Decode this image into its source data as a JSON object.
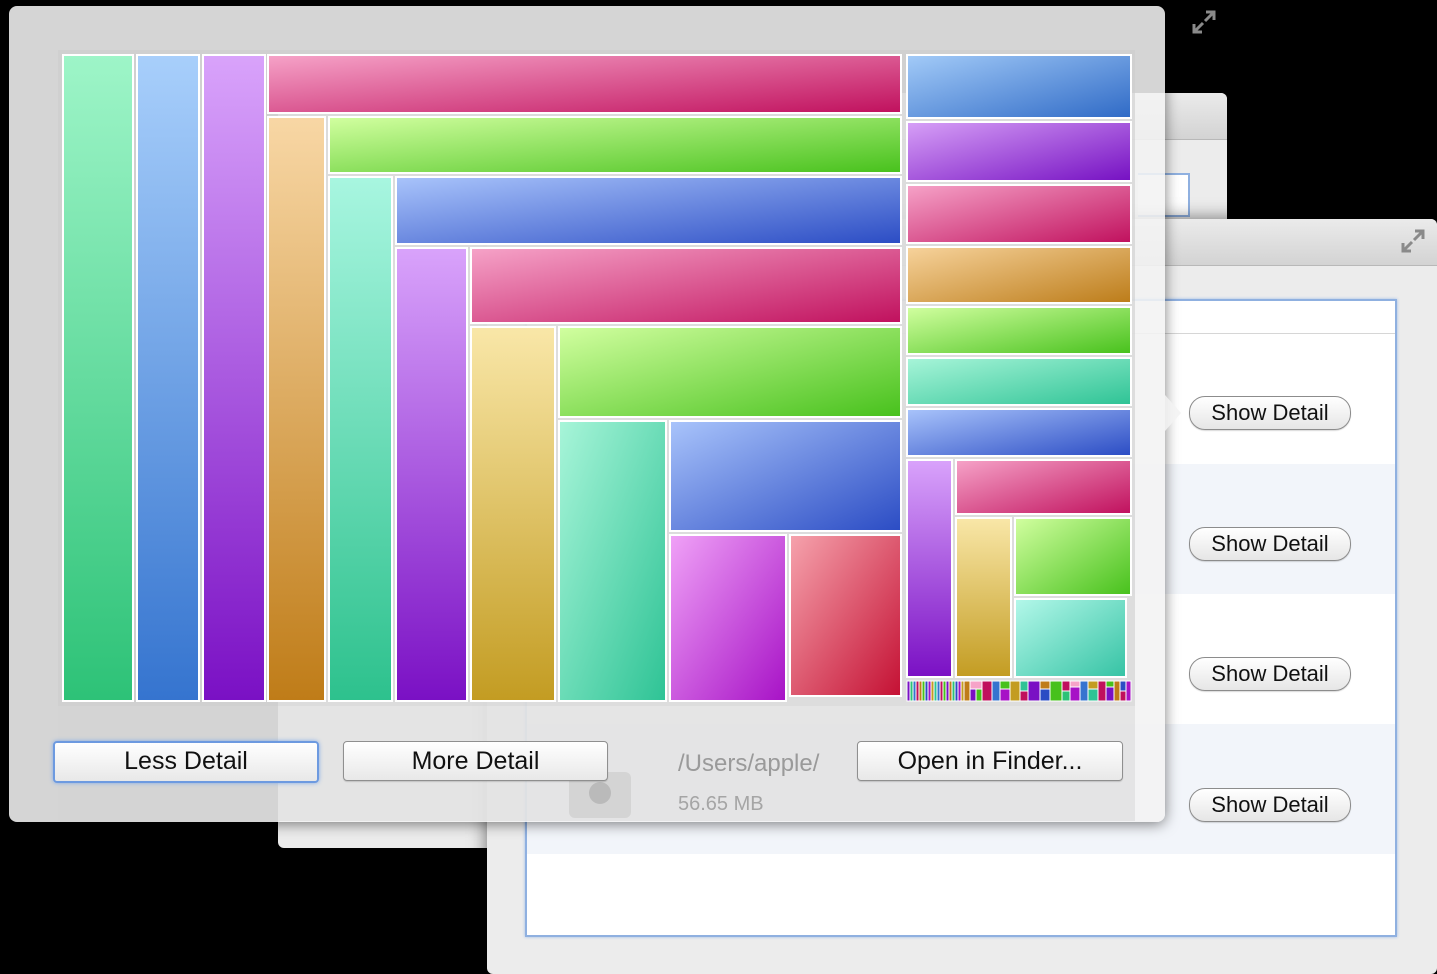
{
  "list_window": {
    "rows": [
      {
        "button_label": "Show Detail"
      },
      {
        "button_label": "Show Detail"
      },
      {
        "button_label": "Show Detail"
      },
      {
        "button_label": "Show Detail"
      }
    ]
  },
  "background_entry": {
    "path": "/Users/apple/",
    "size": "56.65 MB"
  },
  "popover": {
    "less_detail_label": "Less Detail",
    "more_detail_label": "More Detail",
    "open_in_finder_label": "Open in Finder..."
  },
  "icons": {
    "expand": "expand-icon",
    "folder": "folder-icon"
  },
  "colors": {
    "treemap_palette": [
      "#34c27a",
      "#3a7fd4",
      "#7f16c8",
      "#c1176a",
      "#c1801f",
      "#4ac42a",
      "#2ec49a",
      "#2a46c6",
      "#c1a12a"
    ],
    "focus_ring": "#6d9ae0"
  }
}
